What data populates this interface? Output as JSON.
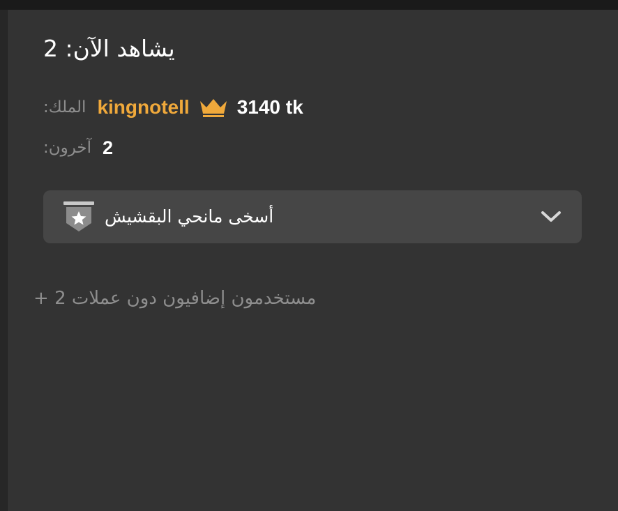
{
  "header": {
    "title": "يشاهد الآن: 2"
  },
  "king": {
    "label": "الملك:",
    "username": "kingnotell",
    "tokens": "3140 tk",
    "icon": "crown-icon",
    "name_color": "#f0a93b"
  },
  "others": {
    "label": "آخرون:",
    "count": "2"
  },
  "dropdown": {
    "label": "أسخى مانحي البقشيش",
    "badge_icon": "star-badge-icon",
    "chevron_icon": "chevron-down-icon"
  },
  "footer": {
    "text": "مستخدمون إضافيون دون عملات 2 +"
  }
}
